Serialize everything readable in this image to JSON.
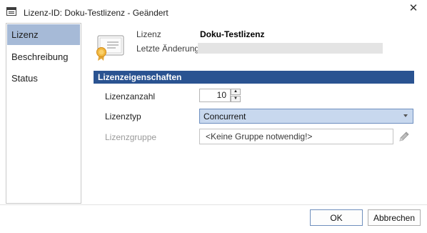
{
  "window": {
    "title": "Lizenz-ID: Doku-Testlizenz - Geändert",
    "close_glyph": "✕"
  },
  "sidebar": {
    "items": [
      {
        "label": "Lizenz",
        "active": true
      },
      {
        "label": "Beschreibung",
        "active": false
      },
      {
        "label": "Status",
        "active": false
      }
    ]
  },
  "header": {
    "license_label": "Lizenz",
    "license_value": "Doku-Testlizenz",
    "last_change_label": "Letzte Änderung",
    "last_change_value": ""
  },
  "section": {
    "title": "Lizenzeigenschaften"
  },
  "fields": {
    "count_label": "Lizenzanzahl",
    "count_value": "10",
    "type_label": "Lizenztyp",
    "type_value": "Concurrent",
    "group_label": "Lizenzgruppe",
    "group_value": "<Keine Gruppe notwendig!>"
  },
  "footer": {
    "ok_label": "OK",
    "cancel_label": "Abbrechen"
  },
  "colors": {
    "accent": "#2a5391",
    "selection": "#a6bad7",
    "combo_bg": "#c8d8ee"
  },
  "icons": {
    "app": "window-icon",
    "certificate": "certificate-icon",
    "edit": "pencil-icon"
  }
}
